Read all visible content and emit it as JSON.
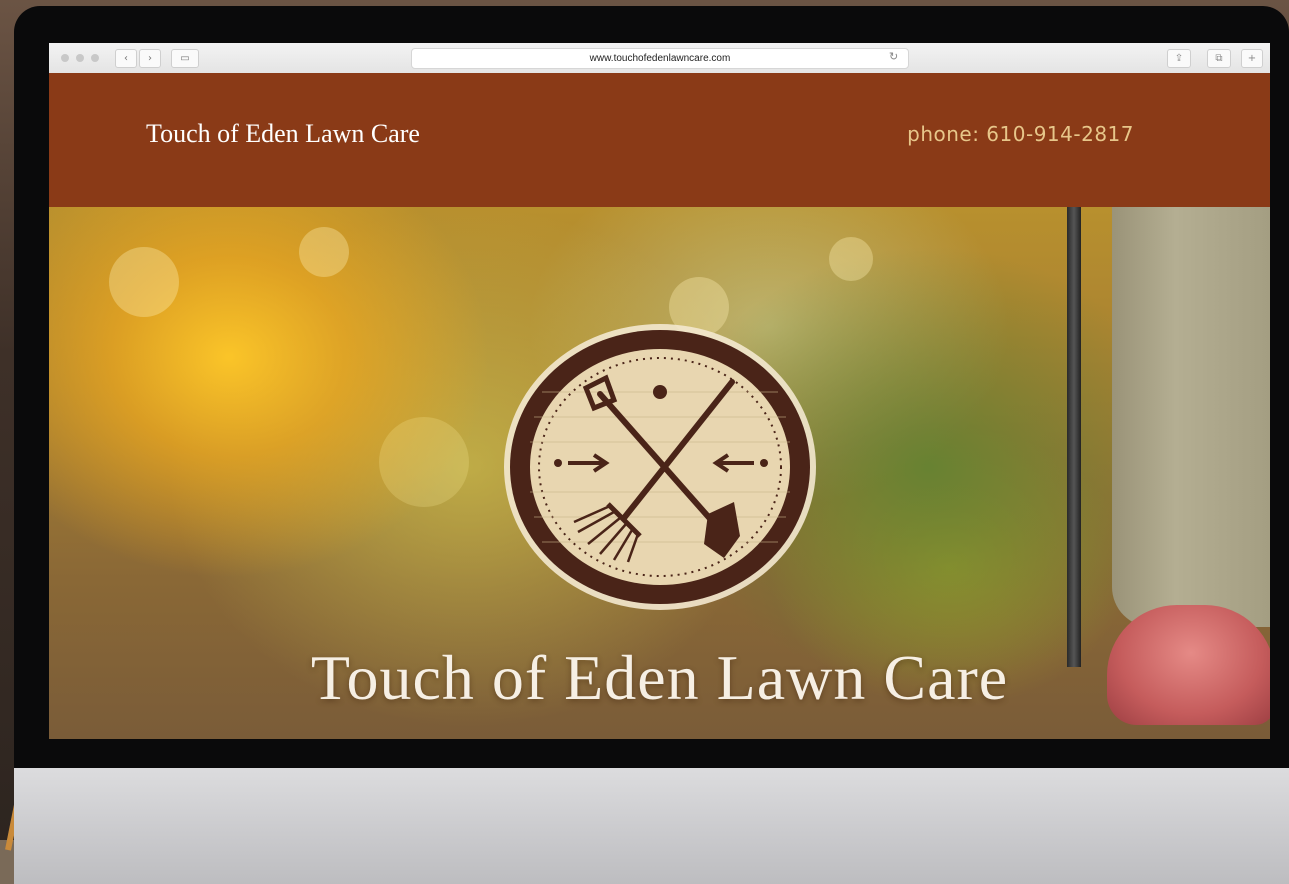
{
  "browser": {
    "url": "www.touchofedenlawncare.com",
    "back_label": "‹",
    "forward_label": "›",
    "sidebar_label": "▭",
    "reload_label": "↻",
    "share_label": "⇪",
    "tabs_label": "⧉",
    "new_tab_label": "+"
  },
  "site": {
    "brand": "Touch of Eden Lawn Care",
    "phone": "phone: 610-914-2817"
  },
  "hero": {
    "title": "Touch of Eden Lawn Care",
    "logo_icon": "crossed-shovel-and-rake-icon"
  },
  "colors": {
    "header_bg": "#8a3a17",
    "phone_text": "#e7c68a",
    "logo_ring": "#4a2418",
    "logo_fill": "#e8d6b0"
  }
}
